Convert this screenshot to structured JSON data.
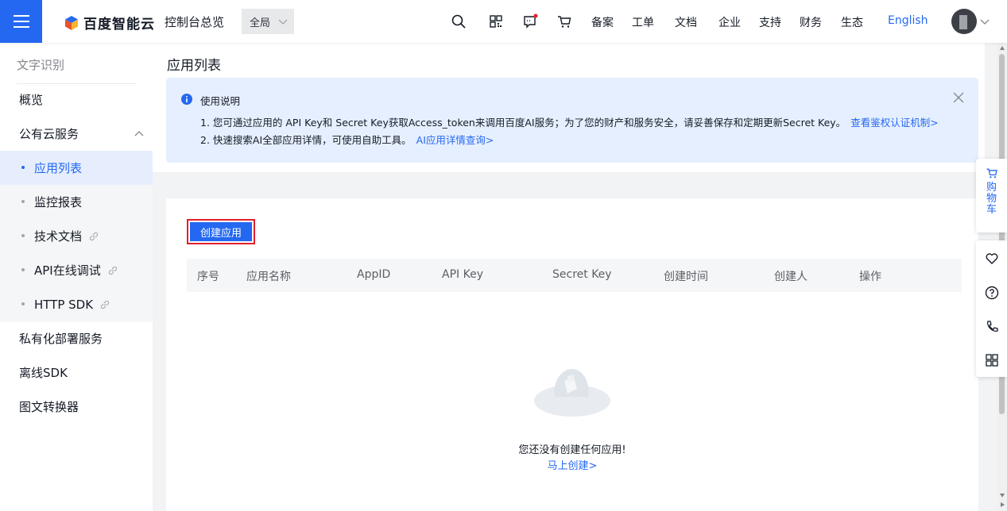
{
  "header": {
    "brand": "百度智能云",
    "console_link": "控制台总览",
    "scope": "全局",
    "nav": [
      "备案",
      "工单",
      "文档",
      "企业",
      "支持",
      "财务",
      "生态"
    ],
    "language": "English",
    "icons": [
      "search-icon",
      "qr-code-icon",
      "message-icon",
      "cart-icon"
    ]
  },
  "sidebar": {
    "title": "文字识别",
    "overview": "概览",
    "public_group": "公有云服务",
    "public_items": [
      {
        "label": "应用列表",
        "active": true,
        "link": false
      },
      {
        "label": "监控报表",
        "active": false,
        "link": false
      },
      {
        "label": "技术文档",
        "active": false,
        "link": true
      },
      {
        "label": "API在线调试",
        "active": false,
        "link": true
      },
      {
        "label": "HTTP SDK",
        "active": false,
        "link": true
      }
    ],
    "private_deploy": "私有化部署服务",
    "offline_sdk": "离线SDK",
    "converter": "图文转换器"
  },
  "page": {
    "title": "应用列表",
    "notice": {
      "title": "使用说明",
      "line1": "1. 您可通过应用的 API Key和 Secret Key获取Access_token来调用百度AI服务；为了您的财产和服务安全，请妥善保存和定期更新Secret Key。",
      "line1_link": "查看鉴权认证机制>",
      "line2": "2. 快速搜索AI全部应用详情，可使用自助工具。",
      "line2_link": "AI应用详情查询>"
    },
    "create_button": "创建应用",
    "table_headers": [
      "序号",
      "应用名称",
      "AppID",
      "API Key",
      "Secret Key",
      "创建时间",
      "创建人",
      "操作"
    ],
    "empty_text": "您还没有创建任何应用!",
    "empty_link": "马上创建>"
  },
  "float_bar": {
    "cart_label": "购物车",
    "tools": [
      "heart-icon",
      "help-icon",
      "phone-icon",
      "grid-icon"
    ]
  },
  "colors": {
    "accent": "#2468f2",
    "notice_bg": "#e6efff",
    "highlight_border": "#e0202d"
  }
}
